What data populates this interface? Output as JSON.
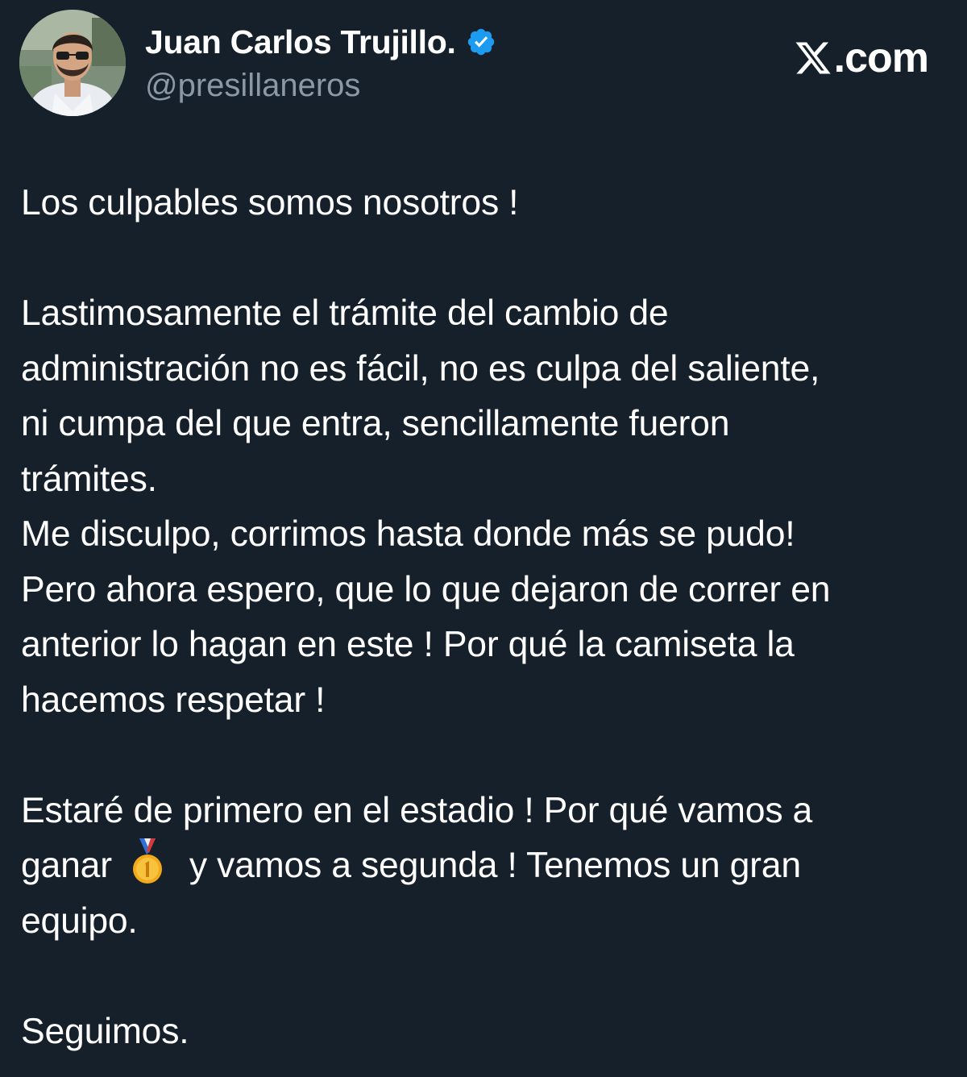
{
  "brand": {
    "icon": "x-logo-icon",
    "text": ".com"
  },
  "author": {
    "name": "Juan Carlos Trujillo.",
    "handle": "@presillaneros",
    "verified": true,
    "verified_color": "#1d9bf0"
  },
  "tweet": {
    "p1": {
      "l1": "Los culpables somos nosotros !"
    },
    "p2": {
      "l1": "Lastimosamente el trámite del cambio de",
      "l2": "administración no es fácil, no es culpa del saliente,",
      "l3": "ni cumpa del que entra, sencillamente fueron",
      "l4": "trámites.",
      "l5": "Me disculpo, corrimos hasta donde más se pudo!",
      "l6": "Pero ahora espero, que lo que dejaron de correr en",
      "l7": "anterior lo hagan en este ! Por qué la camiseta la",
      "l8": "hacemos respetar !"
    },
    "p3": {
      "l1": "Estaré de primero en el estadio ! Por qué vamos a",
      "l2a": "ganar",
      "medal_icon": "first-place-medal-icon",
      "l2b": "y vamos a segunda ! Tenemos un gran",
      "l3": "equipo."
    },
    "p4": {
      "l1": "Seguimos."
    }
  },
  "colors": {
    "background": "#16202b",
    "text": "#ffffff",
    "secondary_text": "#8b98a5"
  }
}
